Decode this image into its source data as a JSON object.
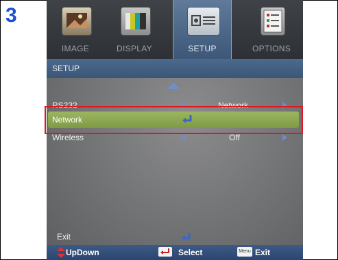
{
  "step_number": "3",
  "tabs": [
    {
      "label": "IMAGE",
      "icon": "image-icon"
    },
    {
      "label": "DISPLAY",
      "icon": "display-icon"
    },
    {
      "label": "SETUP",
      "icon": "setup-icon",
      "active": true
    },
    {
      "label": "OPTIONS",
      "icon": "options-icon"
    }
  ],
  "header": {
    "title": "SETUP"
  },
  "menu": {
    "rows": [
      {
        "label": "RS232",
        "value": "Network"
      },
      {
        "label": "Network",
        "value": ""
      },
      {
        "label": "Wireless",
        "value": "Off"
      }
    ],
    "exit_label": "Exit"
  },
  "bottom_bar": {
    "updown_label": "UpDown",
    "select_label": "Select",
    "menu_key_label": "Menu",
    "exit_label": "Exit"
  },
  "colors": {
    "step_number": "#1a4fd0",
    "highlight_border": "#e0171f",
    "selected_row": "#8fab52",
    "header_bar": "#4c6a8d",
    "bottom_bar": "#345082"
  }
}
